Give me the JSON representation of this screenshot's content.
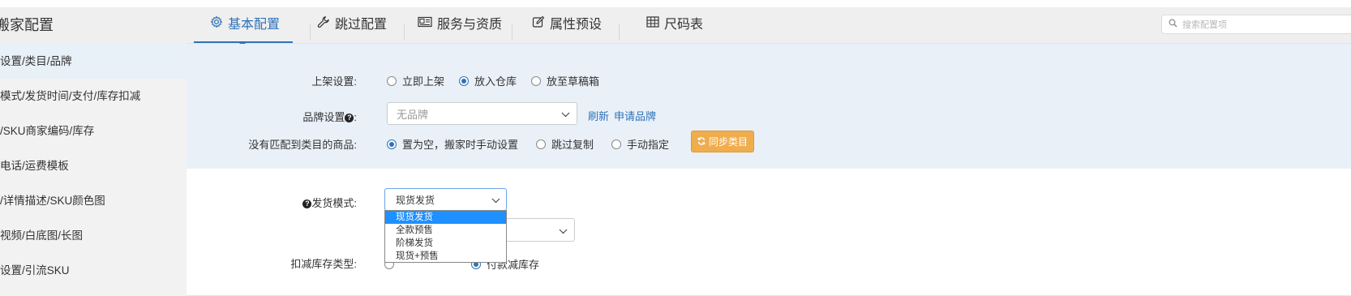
{
  "sidebar": {
    "title": "搬家配置",
    "items": [
      {
        "label": "设置/类目/品牌"
      },
      {
        "label": "模式/发货时间/支付/库存扣减"
      },
      {
        "label": "/SKU商家编码/库存"
      },
      {
        "label": "电话/运费模板"
      },
      {
        "label": "/详情描述/SKU颜色图"
      },
      {
        "label": "视频/白底图/长图"
      },
      {
        "label": "设置/引流SKU"
      }
    ]
  },
  "tabs": [
    {
      "label": "基本配置",
      "icon": "gear-icon"
    },
    {
      "label": "跳过配置",
      "icon": "wrench-icon"
    },
    {
      "label": "服务与资质",
      "icon": "id-card-icon"
    },
    {
      "label": "属性预设",
      "icon": "edit-icon"
    },
    {
      "label": "尺码表",
      "icon": "table-icon"
    }
  ],
  "search": {
    "placeholder": "搜索配置项"
  },
  "listing": {
    "label": "上架设置:",
    "options": [
      "立即上架",
      "放入仓库",
      "放至草稿箱"
    ],
    "selected": "放入仓库"
  },
  "brand": {
    "label": "品牌设置",
    "colon": ":",
    "placeholder": "无品牌",
    "refresh": "刷新",
    "apply": "申请品牌"
  },
  "unmatched": {
    "label": "没有匹配到类目的商品:",
    "options": [
      "置为空，搬家时手动设置",
      "跳过复制",
      "手动指定"
    ],
    "selected": "置为空，搬家时手动设置",
    "sync_button": "同步类目"
  },
  "shipping": {
    "label": "发货模式:",
    "value": "现货发货",
    "options": [
      "现货发货",
      "全款预售",
      "阶梯发货",
      "现货+预售"
    ],
    "highlighted": "现货发货"
  },
  "inventory": {
    "label": "扣减库存类型:",
    "visible_option": "付款减库存"
  },
  "colors": {
    "accent": "#2f73b8",
    "sync": "#f0ad4e"
  }
}
